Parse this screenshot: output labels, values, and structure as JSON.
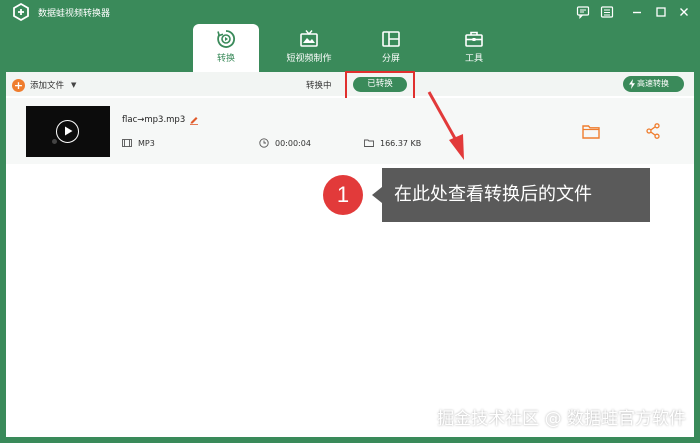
{
  "app": {
    "title": "数据蛙视频转换器"
  },
  "tabs": [
    {
      "label": "转换",
      "icon": "convert-icon",
      "active": true
    },
    {
      "label": "短视频制作",
      "icon": "tv-icon",
      "active": false
    },
    {
      "label": "分屏",
      "icon": "split-screen-icon",
      "active": false
    },
    {
      "label": "工具",
      "icon": "toolbox-icon",
      "active": false
    }
  ],
  "toolbar": {
    "add_plus": "+",
    "add_label": "添加文件",
    "add_caret": "▼",
    "filter_converting": "转换中",
    "filter_converted": "已转换",
    "fast_convert": "高速转换"
  },
  "file": {
    "name": "flac→mp3.mp3",
    "format": "MP3",
    "duration": "00:00:04",
    "size": "166.37 KB"
  },
  "annotation": {
    "number": "1",
    "text": "在此处查看转换后的文件"
  },
  "watermark": "掘金技术社区 @ 数据蛙官方软件",
  "colors": {
    "brand_green": "#3a8a5a",
    "accent_orange": "#ef7d2e",
    "highlight_red": "#e0302e",
    "callout_gray": "#5a5a5a"
  }
}
